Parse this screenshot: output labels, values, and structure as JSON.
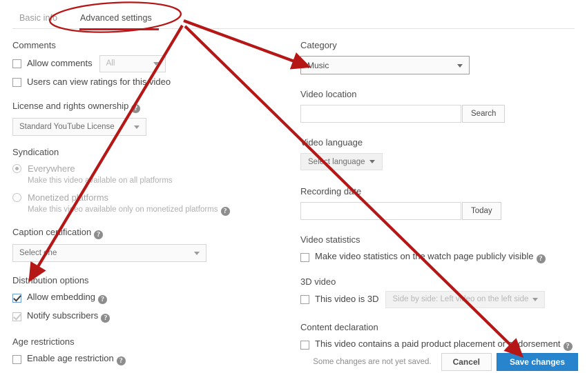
{
  "tabs": {
    "inactive_label": "Basic info",
    "active_label": "Advanced settings"
  },
  "left_column": {
    "comments": {
      "title": "Comments",
      "allow_comments_label": "Allow comments",
      "allow_comments_checked": false,
      "comments_select_value": "All",
      "ratings_label": "Users can view ratings for this video",
      "ratings_checked": false
    },
    "license": {
      "title": "License and rights ownership",
      "select_value": "Standard YouTube License"
    },
    "syndication": {
      "title": "Syndication",
      "options": [
        {
          "label": "Everywhere",
          "description": "Make this video available on all platforms",
          "selected": true,
          "has_help": false
        },
        {
          "label": "Monetized platforms",
          "description": "Make this video available only on monetized platforms",
          "selected": false,
          "has_help": true
        }
      ]
    },
    "caption_certification": {
      "title": "Caption certification",
      "select_value": "Select one"
    },
    "distribution": {
      "title": "Distribution options",
      "allow_embedding_label": "Allow embedding",
      "allow_embedding_checked": true,
      "notify_subscribers_label": "Notify subscribers",
      "notify_subscribers_checked": true
    },
    "age_restrictions": {
      "title": "Age restrictions",
      "enable_label": "Enable age restriction",
      "enable_checked": false
    }
  },
  "right_column": {
    "category": {
      "title": "Category",
      "select_value": "Music"
    },
    "video_location": {
      "title": "Video location",
      "input_value": "",
      "input_placeholder": "",
      "search_button_label": "Search"
    },
    "video_language": {
      "title": "Video language",
      "select_value": "Select language"
    },
    "recording_date": {
      "title": "Recording date",
      "input_value": "",
      "input_placeholder": "",
      "today_button_label": "Today"
    },
    "video_statistics": {
      "title": "Video statistics",
      "checkbox_label": "Make video statistics on the watch page publicly visible",
      "checked": false
    },
    "video_3d": {
      "title": "3D video",
      "checkbox_label": "This video is 3D",
      "checked": false,
      "select_value": "Side by side: Left video on the left side"
    },
    "content_declaration": {
      "title": "Content declaration",
      "checkbox_label": "This video contains a paid product placement or endorsement",
      "checked": false
    }
  },
  "footer": {
    "unsaved_note": "Some changes are not yet saved.",
    "cancel_label": "Cancel",
    "save_label": "Save changes"
  },
  "annotation": {
    "color": "#b51616",
    "shape": "ellipse-highlight",
    "arrow_count": 3
  }
}
